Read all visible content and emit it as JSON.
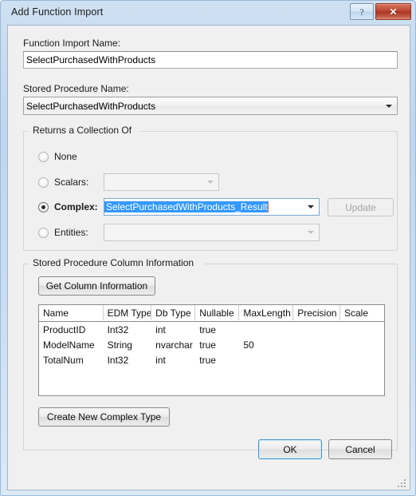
{
  "window": {
    "title": "Add Function Import",
    "help_button": "?",
    "close_button": "✕",
    "accent_color": "#3399ff",
    "titlebar_color": "#c9def2",
    "close_button_color": "#bb4430"
  },
  "form": {
    "function_import_name_label": "Function Import Name:",
    "function_import_name_value": "SelectPurchasedWithProducts",
    "stored_procedure_name_label": "Stored Procedure Name:",
    "stored_procedure_name_value": "SelectPurchasedWithProducts"
  },
  "returns_group": {
    "title": "Returns a Collection Of",
    "options": [
      {
        "label": "None",
        "checked": false,
        "has_combo": false
      },
      {
        "label": "Scalars:",
        "checked": false,
        "has_combo": true,
        "combo_value": "",
        "combo_enabled": false
      },
      {
        "label": "Complex:",
        "checked": true,
        "has_combo": true,
        "combo_value": "SelectPurchasedWithProducts_Result",
        "combo_enabled": true,
        "combo_selected": true
      },
      {
        "label": "Entities:",
        "checked": false,
        "has_combo": true,
        "combo_value": "",
        "combo_enabled": false
      }
    ],
    "update_button": "Update",
    "update_enabled": false
  },
  "column_group": {
    "title": "Stored Procedure Column Information",
    "get_column_information_button": "Get Column Information",
    "create_new_complex_type_button": "Create New Complex Type",
    "table": {
      "columns": [
        "Name",
        "EDM Type",
        "Db Type",
        "Nullable",
        "MaxLength",
        "Precision",
        "Scale"
      ],
      "rows": [
        [
          "ProductID",
          "Int32",
          "int",
          "true",
          "",
          "",
          ""
        ],
        [
          "ModelName",
          "String",
          "nvarchar",
          "true",
          "50",
          "",
          ""
        ],
        [
          "TotalNum",
          "Int32",
          "int",
          "true",
          "",
          "",
          ""
        ]
      ]
    }
  },
  "footer": {
    "ok_button": "OK",
    "cancel_button": "Cancel"
  }
}
